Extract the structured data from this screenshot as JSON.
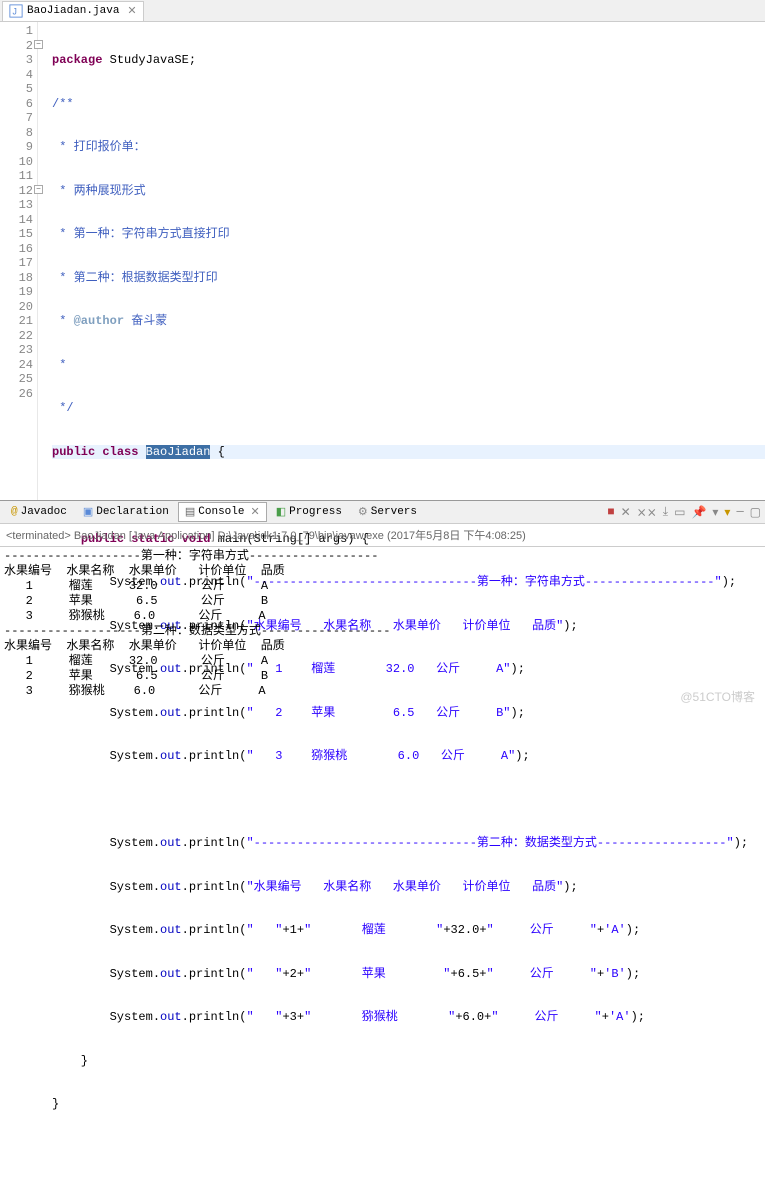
{
  "tab": {
    "title": "BaoJiadan.java",
    "close": "✕"
  },
  "lines": {
    "l1": {
      "a": "package",
      "b": " StudyJavaSE;"
    },
    "l2": {
      "a": "/**"
    },
    "l3": {
      "a": " * 打印报价单："
    },
    "l4": {
      "a": " * 两种展现形式"
    },
    "l5": {
      "a": " * 第一种：字符串方式直接打印"
    },
    "l6": {
      "a": " * 第二种：根据数据类型打印"
    },
    "l7": {
      "a": " * ",
      "b": "@author",
      "c": " 奋斗蒙"
    },
    "l8": {
      "a": " *"
    },
    "l9": {
      "a": " */"
    },
    "l10": {
      "a": "public",
      "b": " ",
      "c": "class",
      "d": " ",
      "e": "BaoJiadan",
      "f": " {"
    },
    "l11": {
      "a": ""
    },
    "l12": {
      "a": "    ",
      "b": "public",
      "c": " ",
      "d": "static",
      "e": " ",
      "f": "void",
      "g": " main(String[] args) {"
    },
    "l13": {
      "a": "        System.",
      "b": "out",
      "c": ".println(",
      "d": "\"-------------------------------第一种：字符串方式------------------\"",
      "e": ");"
    },
    "l14": {
      "a": "        System.",
      "b": "out",
      "c": ".println(",
      "d": "\"水果编号   水果名称   水果单价   计价单位   品质\"",
      "e": ");"
    },
    "l15": {
      "a": "        System.",
      "b": "out",
      "c": ".println(",
      "d": "\"   1    榴莲       32.0   公斤     A\"",
      "e": ");"
    },
    "l16": {
      "a": "        System.",
      "b": "out",
      "c": ".println(",
      "d": "\"   2    苹果        6.5   公斤     B\"",
      "e": ");"
    },
    "l17": {
      "a": "        System.",
      "b": "out",
      "c": ".println(",
      "d": "\"   3    猕猴桃       6.0   公斤     A\"",
      "e": ");"
    },
    "l18": {
      "a": ""
    },
    "l19": {
      "a": "        System.",
      "b": "out",
      "c": ".println(",
      "d": "\"-------------------------------第二种：数据类型方式------------------\"",
      "e": ");"
    },
    "l20": {
      "a": "        System.",
      "b": "out",
      "c": ".println(",
      "d": "\"水果编号   水果名称   水果单价   计价单位   品质\"",
      "e": ");"
    },
    "l21": {
      "a": "        System.",
      "b": "out",
      "c": ".println(",
      "d1": "\"   \"",
      "p1": "+1+",
      "d2": "\"       榴莲       \"",
      "p2": "+32.0+",
      "d3": "\"     公斤     \"",
      "p3": "+",
      "d4": "'A'",
      "e": ");"
    },
    "l22": {
      "a": "        System.",
      "b": "out",
      "c": ".println(",
      "d1": "\"   \"",
      "p1": "+2+",
      "d2": "\"       苹果        \"",
      "p2": "+6.5+",
      "d3": "\"     公斤     \"",
      "p3": "+",
      "d4": "'B'",
      "e": ");"
    },
    "l23": {
      "a": "        System.",
      "b": "out",
      "c": ".println(",
      "d1": "\"   \"",
      "p1": "+3+",
      "d2": "\"       猕猴桃       \"",
      "p2": "+6.0+",
      "d3": "\"     公斤     \"",
      "p3": "+",
      "d4": "'A'",
      "e": ");"
    },
    "l24": {
      "a": "    }"
    },
    "l25": {
      "a": "}"
    },
    "l26": {
      "a": ""
    }
  },
  "gutter": [
    "1",
    "2",
    "3",
    "4",
    "5",
    "6",
    "7",
    "8",
    "9",
    "10",
    "11",
    "12",
    "13",
    "14",
    "15",
    "16",
    "17",
    "18",
    "19",
    "20",
    "21",
    "22",
    "23",
    "24",
    "25",
    "26"
  ],
  "views": {
    "javadoc": "Javadoc",
    "declaration": "Declaration",
    "console": "Console",
    "progress": "Progress",
    "servers": "Servers"
  },
  "terminated": "<terminated> BaoJiadan [Java Application] D:\\Java\\jdk1.7.0_79\\bin\\javaw.exe (2017年5月8日 下午4:08:25)",
  "consoleOut": "-------------------第一种：字符串方式------------------\n水果编号  水果名称  水果单价   计价单位  品质\n   1     榴莲     32.0      公斤     A\n   2     苹果      6.5      公斤     B\n   3     猕猴桃    6.0      公斤     A\n-------------------第二种：数据类型方式------------------\n水果编号  水果名称  水果单价   计价单位  品质\n   1     榴莲     32.0      公斤     A\n   2     苹果      6.5      公斤     B\n   3     猕猴桃    6.0      公斤     A",
  "watermark": "@51CTO博客"
}
